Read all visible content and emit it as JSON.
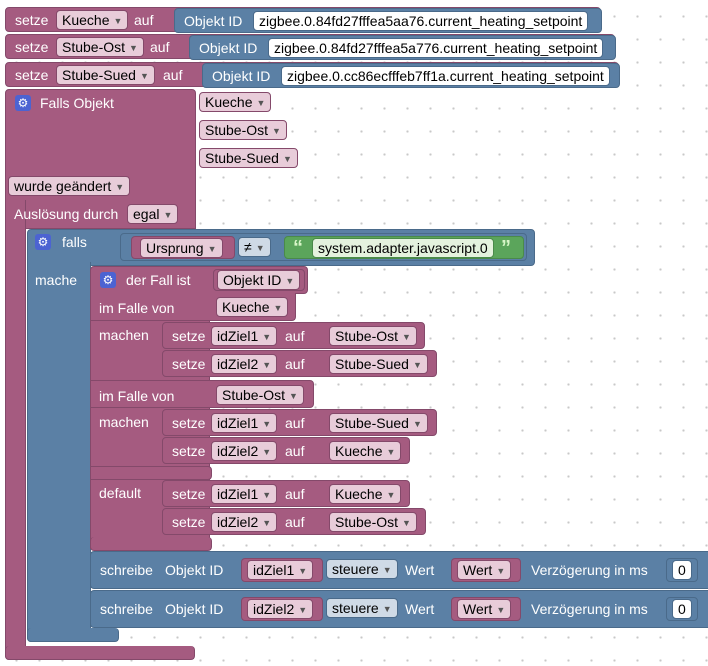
{
  "labels": {
    "setze": "setze",
    "auf": "auf",
    "objekt_id": "Objekt ID",
    "falls_objekt": "Falls Objekt",
    "ausloesung_durch": "Auslösung durch",
    "falls": "falls",
    "mache": "mache",
    "der_fall_ist": "der Fall ist",
    "im_falle_von": "im Falle von",
    "machen": "machen",
    "default": "default",
    "schreibe": "schreibe",
    "wert": "Wert",
    "verzoegerung": "Verzögerung in ms"
  },
  "set_blocks": [
    {
      "var": "Kueche",
      "id": "zigbee.0.84fd27fffea5aa76.current_heating_setpoint"
    },
    {
      "var": "Stube-Ost",
      "id": "zigbee.0.84fd27fffea5a776.current_heating_setpoint"
    },
    {
      "var": "Stube-Sued",
      "id": "zigbee.0.cc86ecfffeb7ff1a.current_heating_setpoint"
    }
  ],
  "trigger": {
    "objects": [
      "Kueche",
      "Stube-Ost",
      "Stube-Sued"
    ],
    "change": "wurde geändert",
    "ausloesung": "egal"
  },
  "condition": {
    "left": "Ursprung",
    "operator": "≠",
    "right": "system.adapter.javascript.0"
  },
  "switch": {
    "subject": "Objekt ID",
    "cases": [
      {
        "value": "Kueche",
        "actions": [
          {
            "var": "idZiel1",
            "value": "Stube-Ost"
          },
          {
            "var": "idZiel2",
            "value": "Stube-Sued"
          }
        ]
      },
      {
        "value": "Stube-Ost",
        "actions": [
          {
            "var": "idZiel1",
            "value": "Stube-Sued"
          },
          {
            "var": "idZiel2",
            "value": "Kueche"
          }
        ]
      }
    ],
    "default_actions": [
      {
        "var": "idZiel1",
        "value": "Kueche"
      },
      {
        "var": "idZiel2",
        "value": "Stube-Ost"
      }
    ]
  },
  "writes": [
    {
      "target": "idZiel1",
      "mode": "steuere",
      "value": "Wert",
      "delay": "0"
    },
    {
      "target": "idZiel2",
      "mode": "steuere",
      "value": "Wert",
      "delay": "0"
    }
  ],
  "colors": {
    "event_block": "#a55b80",
    "logic_block": "#5b80a5",
    "text_block": "#5ba55b",
    "mutator_gear": "#4c63d2"
  }
}
